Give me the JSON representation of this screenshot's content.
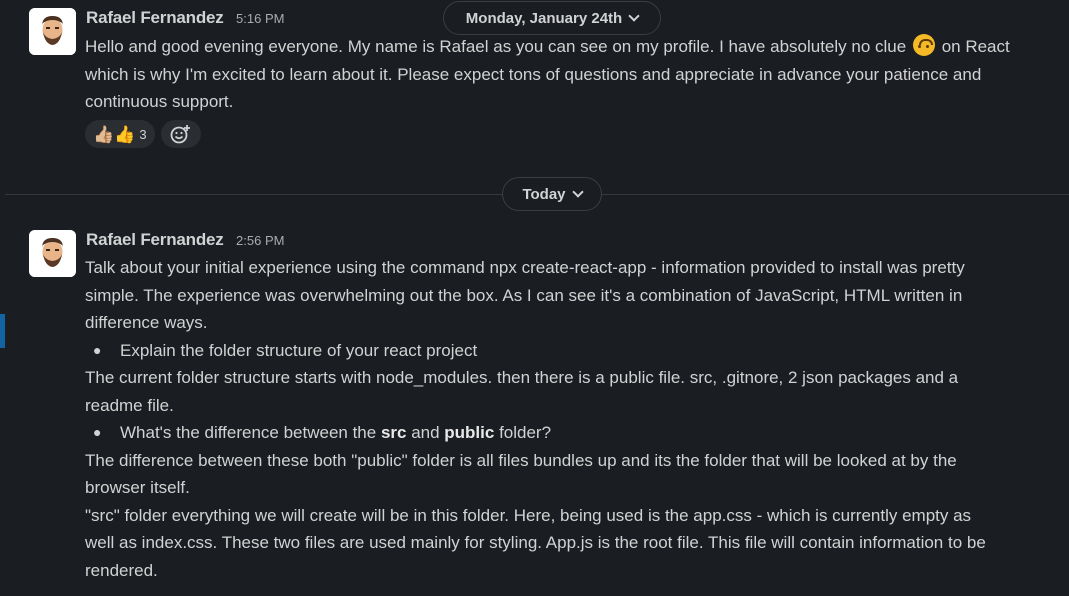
{
  "date_dividers": {
    "top_label": "Monday, January 24th",
    "today_label": "Today"
  },
  "messages": [
    {
      "sender": "Rafael Fernandez",
      "time": "5:16 PM",
      "line1_a": "Hello and good evening everyone. My name is Rafael as you can see on my profile. I have absolutely no clue",
      "line1_b": "on React",
      "line2": "which is why I'm excited to learn about it. Please expect tons of questions and appreciate in advance your patience and",
      "line3": "continuous support.",
      "inline_emoji": "upside-down-face-icon",
      "reactions": [
        {
          "emoji": "👍🏼👍",
          "count": "3"
        }
      ]
    },
    {
      "sender": "Rafael Fernandez",
      "time": "2:56 PM",
      "lines": [
        "Talk about your initial experience using the command npx create-react-app - information provided to install was pretty",
        "simple. The experience was overwhelming out the box. As I can see it's a combination of JavaScript, HTML written in",
        "difference ways."
      ],
      "bullet1": "Explain the folder structure of your react project",
      "answer1": [
        "The current folder structure starts with node_modules. then there is a public file. src, .gitnore, 2 json packages and a",
        "readme file."
      ],
      "bullet2_a": "What's the difference between the ",
      "bullet2_b": "src",
      "bullet2_c": " and ",
      "bullet2_d": "public",
      "bullet2_e": " folder?",
      "answer2": [
        "The difference between these both \"public\" folder is all files bundles up and its the folder that will be looked at by the",
        "browser itself.",
        "\"src\" folder everything we will create will be in this folder. Here, being used is the app.css - which is currently empty as",
        "well as index.css. These two files are used mainly for styling. App.js is the root file. This file will contain information to be",
        "rendered."
      ]
    }
  ],
  "colors": {
    "background": "#1a1d21",
    "text": "#d1d2d3",
    "accent": "#1264a3"
  }
}
